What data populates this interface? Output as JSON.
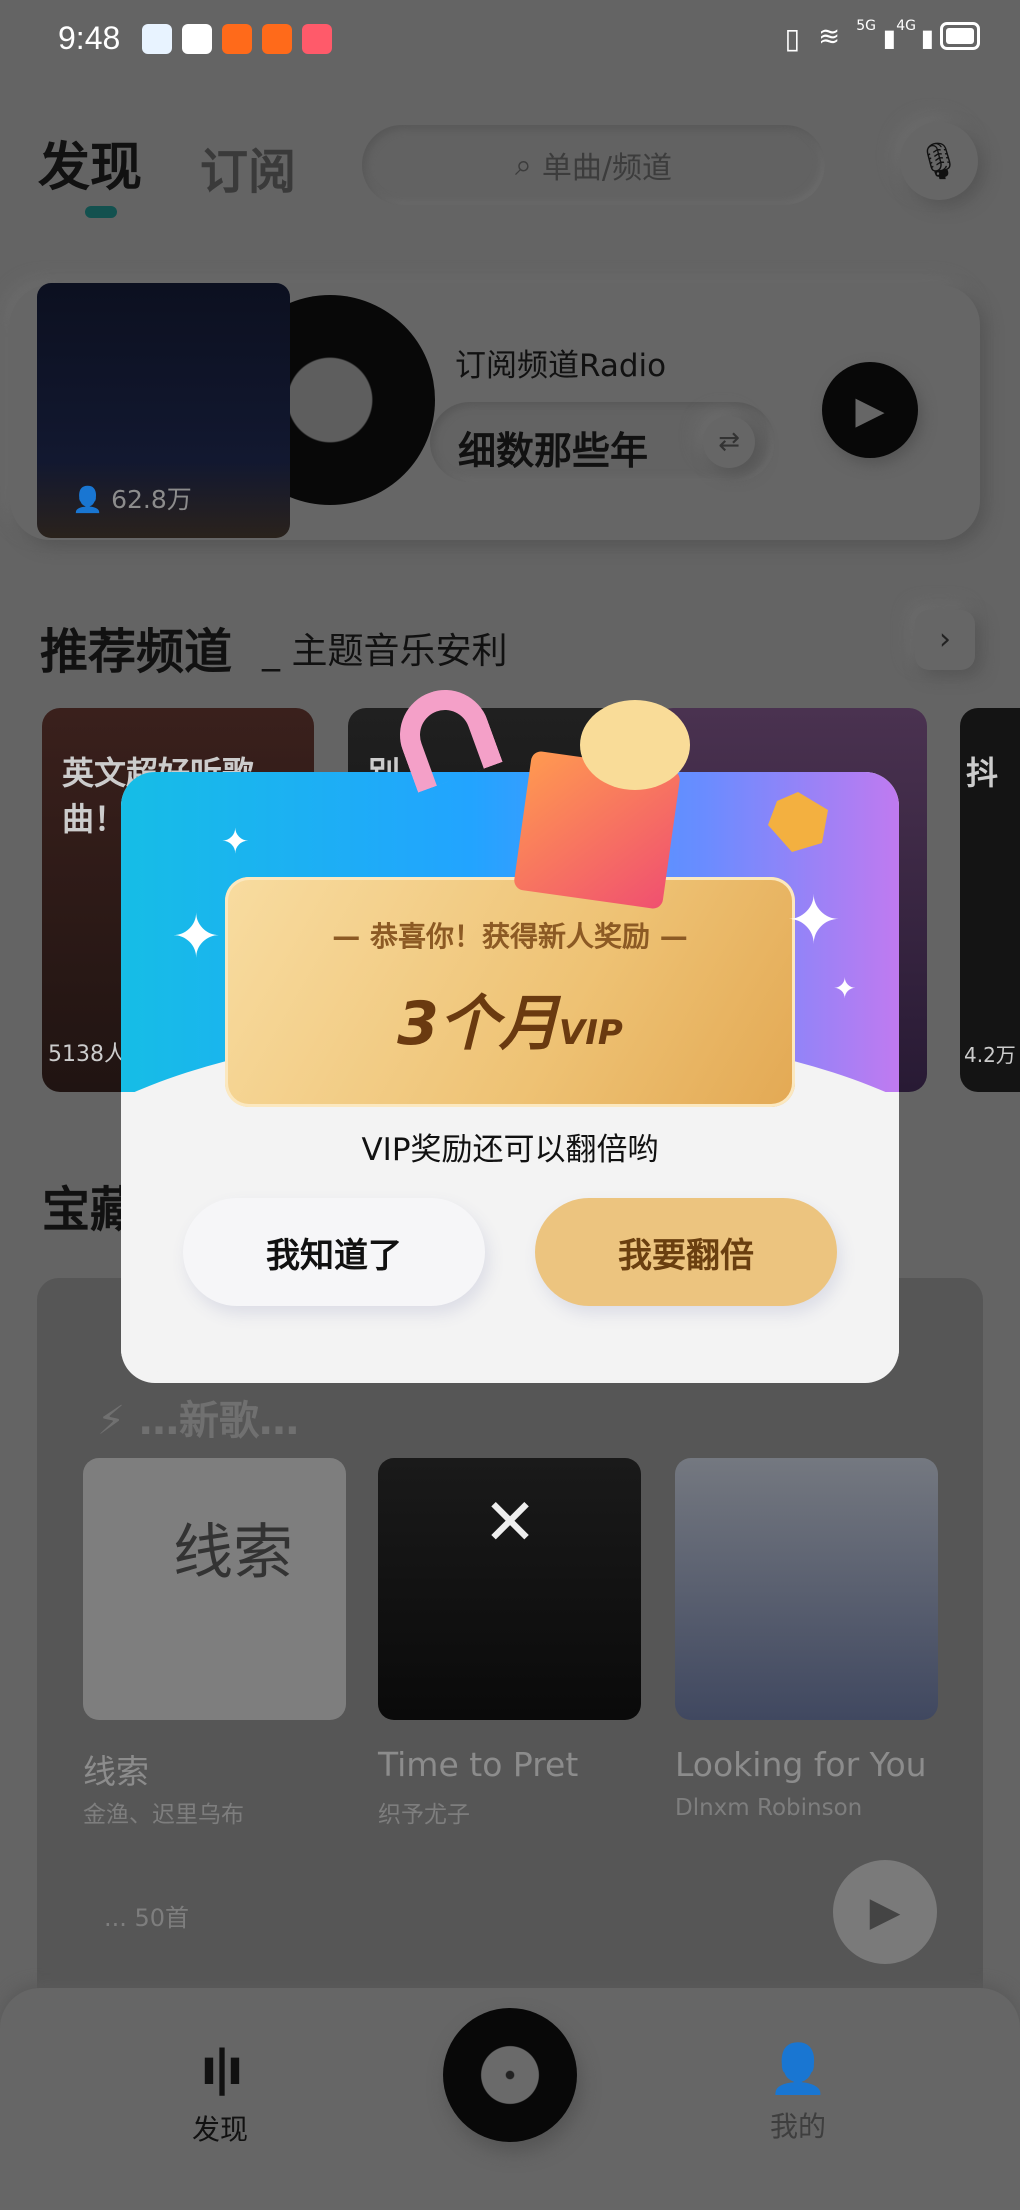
{
  "status_bar": {
    "time": "9:48",
    "network_1": "5G",
    "network_2": "4G"
  },
  "header": {
    "tabs": [
      {
        "label": "发现",
        "active": true
      },
      {
        "label": "订阅",
        "active": false
      }
    ],
    "search_placeholder": "单曲/频道",
    "accent": "#1f8a86"
  },
  "radio": {
    "listeners": "62.8万",
    "title": "订阅频道Radio",
    "song": "细数那些年"
  },
  "recommended": {
    "title": "推荐频道",
    "subtitle": "主题音乐安利",
    "channels": [
      {
        "title": "英文超好听歌曲！",
        "count": "5138人"
      },
      {
        "title": "别..."
      },
      {
        "title": ""
      },
      {
        "title": "抖",
        "count": "4.2万"
      }
    ]
  },
  "treasure": {
    "title": "宝藏",
    "playlist_title": "…新歌…",
    "tracks": [
      {
        "title": "线索",
        "artist": "金渔、迟里乌布",
        "cover_text": "线索"
      },
      {
        "title": "Time to Pret",
        "artist": "织予尤子"
      },
      {
        "title": "Looking for You",
        "artist": "Dlnxm Robinson"
      }
    ],
    "count": "... 50首"
  },
  "nav": {
    "items": [
      {
        "label": "发现",
        "active": true
      },
      {
        "label": "我的",
        "active": false
      }
    ]
  },
  "popup": {
    "banner_header": "恭喜你！获得新人奖励",
    "reward": "3个月",
    "reward_suffix": "VIP",
    "message": "VIP奖励还可以翻倍哟",
    "dismiss_label": "我知道了",
    "double_label": "我要翻倍",
    "gold": "#ecc47f"
  }
}
